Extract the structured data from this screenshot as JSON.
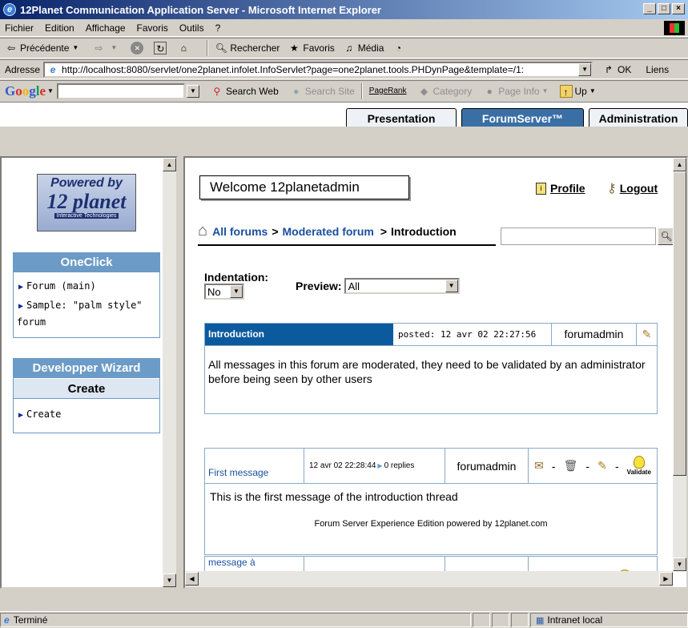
{
  "window": {
    "title": "12Planet Communication Application Server - Microsoft Internet Explorer"
  },
  "menu": [
    "Fichier",
    "Edition",
    "Affichage",
    "Favoris",
    "Outils",
    "?"
  ],
  "toolbar": {
    "back": "Précédente",
    "search": "Rechercher",
    "favorites": "Favoris",
    "media": "Média"
  },
  "address": {
    "label": "Adresse",
    "url": "http://localhost:8080/servlet/one2planet.infolet.InfoServlet?page=one2planet.tools.PHDynPage&template=/1:",
    "go": "OK",
    "links": "Liens"
  },
  "googlebar": {
    "logo": "Google",
    "search_web": "Search Web",
    "search_site": "Search Site",
    "pagerank": "PageRank",
    "category": "Category",
    "page_info": "Page Info",
    "up": "Up"
  },
  "tabs": [
    {
      "label": "Presentation"
    },
    {
      "label": "ForumServer™"
    },
    {
      "label": "Administration"
    }
  ],
  "sidebar": {
    "logo_top": "Powered by",
    "logo_main": "12 planet",
    "logo_sub": "Interactive Technologies",
    "oneclick": {
      "title": "OneClick",
      "items": [
        "Forum (main)",
        "Sample: \"palm style\"",
        "forum"
      ]
    },
    "wizard": {
      "title": "Developper Wizard",
      "subtitle": "Create",
      "items": [
        "Create"
      ]
    }
  },
  "main": {
    "welcome": "Welcome 12planetadmin",
    "profile": "Profile",
    "logout": "Logout",
    "breadcrumb": {
      "all_forums": "All forums",
      "sep1": ">",
      "moderated": "Moderated forum",
      "sep2": ">",
      "current": "Introduction"
    },
    "indentation": {
      "label": "Indentation:",
      "value": "No"
    },
    "preview": {
      "label": "Preview:",
      "value": "All"
    },
    "intro_post": {
      "title": "Introduction",
      "posted": "posted: 12 avr 02 22:27:56",
      "author": "forumadmin",
      "body": "All messages in this forum are moderated, they need to be validated by an administrator before being seen by other users"
    },
    "first_post": {
      "title": "First message",
      "date": "12 avr 02 22:28:44",
      "replies": "0 replies",
      "author": "forumadmin",
      "validate": "Validate",
      "dash": "-",
      "body": "This is the first message of the introduction thread",
      "footer": "Forum Server Experience Edition powered by 12planet.com"
    },
    "second_post": {
      "title": "message à"
    }
  },
  "status": {
    "text": "Terminé",
    "zone": "Intranet local"
  }
}
